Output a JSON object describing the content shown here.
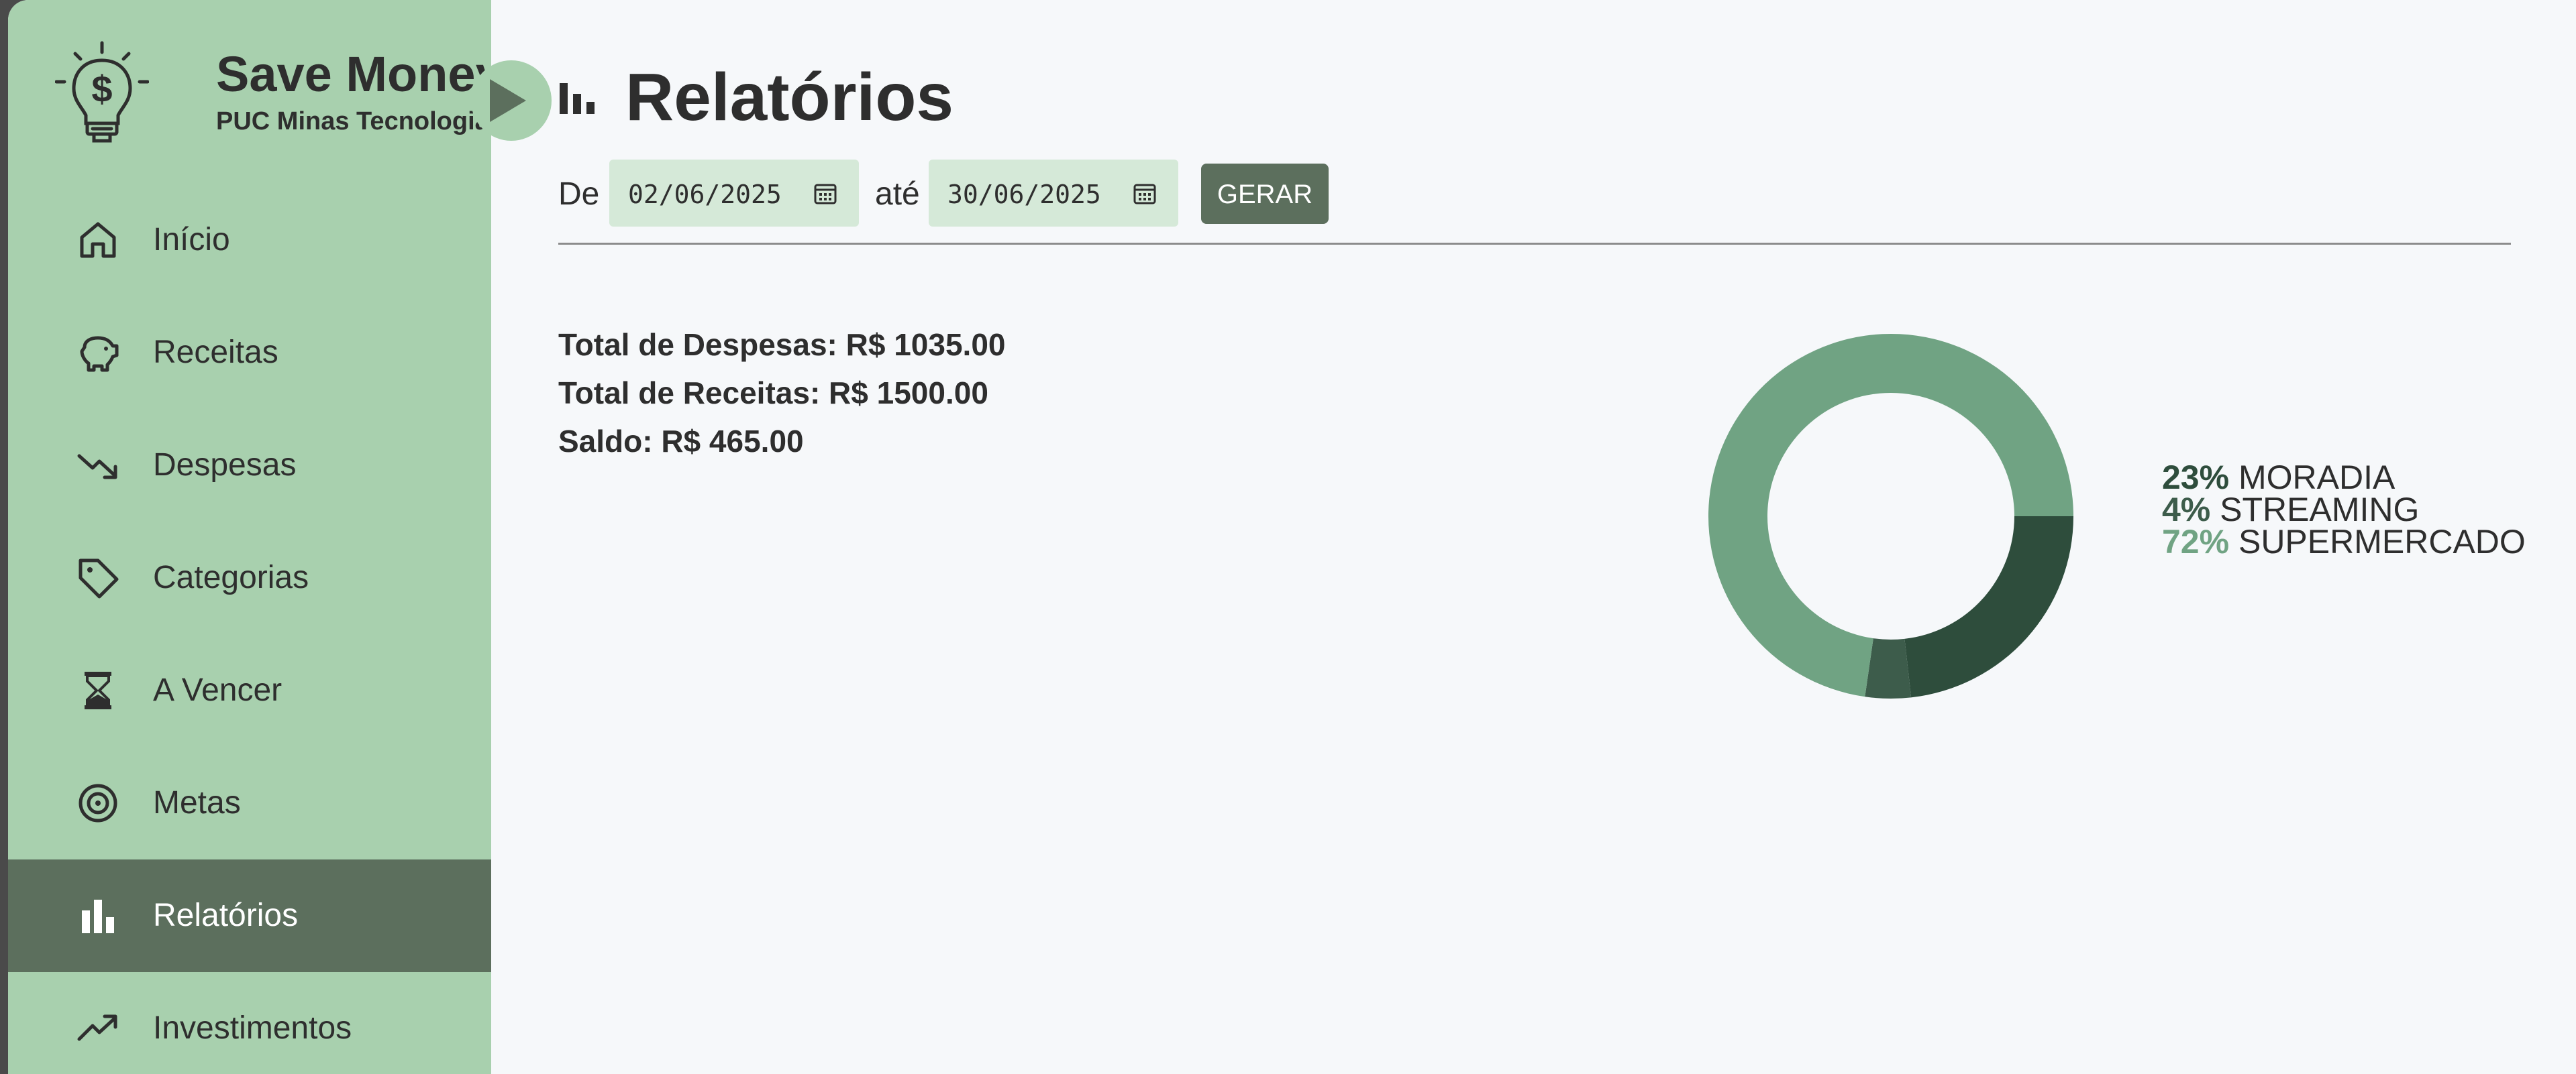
{
  "brand": {
    "title": "Save Money",
    "subtitle": "PUC Minas Tecnologia"
  },
  "sidebar": {
    "items": [
      {
        "label": "Início",
        "icon": "home-icon",
        "active": false
      },
      {
        "label": "Receitas",
        "icon": "piggy-bank-icon",
        "active": false
      },
      {
        "label": "Despesas",
        "icon": "trending-down-icon",
        "active": false
      },
      {
        "label": "Categorias",
        "icon": "tag-icon",
        "active": false
      },
      {
        "label": "A Vencer",
        "icon": "hourglass-icon",
        "active": false
      },
      {
        "label": "Metas",
        "icon": "target-icon",
        "active": false
      },
      {
        "label": "Relatórios",
        "icon": "bar-chart-icon",
        "active": true
      },
      {
        "label": "Investimentos",
        "icon": "trending-up-icon",
        "active": false
      }
    ]
  },
  "page": {
    "title": "Relatórios"
  },
  "filters": {
    "from_label": "De",
    "from_value": "02/06/2025",
    "to_label": "até",
    "to_value": "30/06/2025",
    "generate_label": "GERAR"
  },
  "totals": {
    "expenses": "Total de Despesas: R$ 1035.00",
    "income": "Total de Receitas: R$ 1500.00",
    "balance": "Saldo: R$ 465.00"
  },
  "colors": {
    "sidebar_bg": "#a8d0ae",
    "active_bg": "#5c6f5d",
    "date_bg": "#d5e9d8",
    "page_bg": "#f6f8fa"
  },
  "chart_data": {
    "type": "pie",
    "donut": true,
    "categories": [
      "MORADIA",
      "STREAMING",
      "SUPERMERCADO"
    ],
    "values": [
      23,
      4,
      72
    ],
    "labels": [
      "23%",
      "4%",
      "72%"
    ],
    "colors": [
      "#2e4d3c",
      "#3d5c4b",
      "#70a383"
    ],
    "legend_position": "right"
  }
}
